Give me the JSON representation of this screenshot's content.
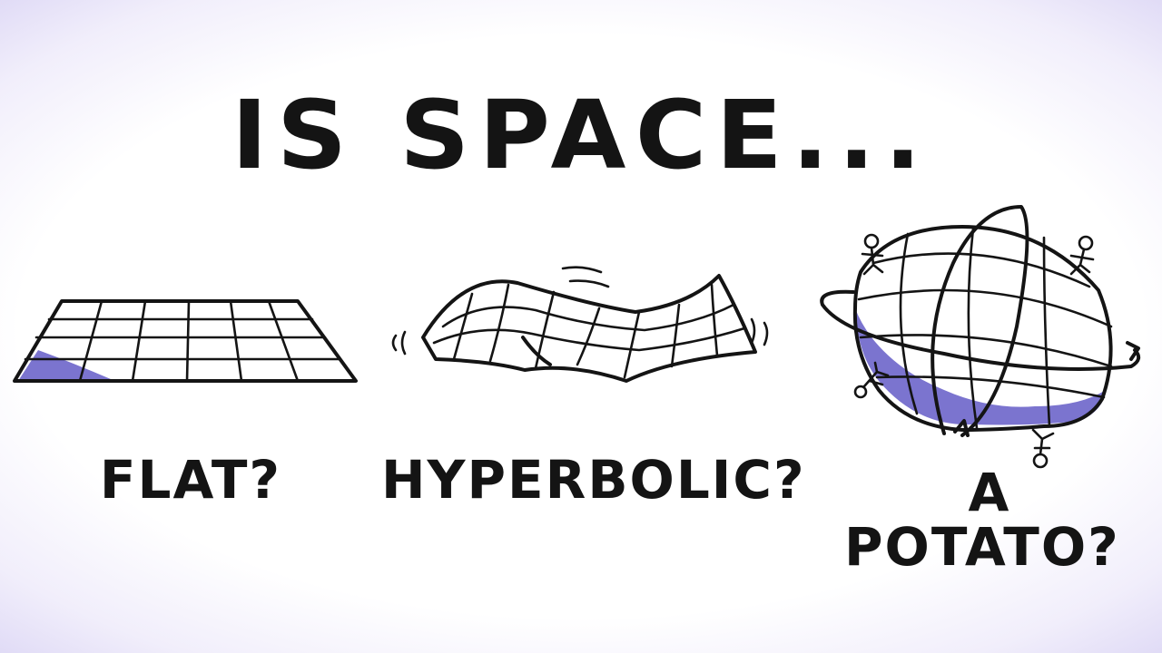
{
  "title": "IS SPACE...",
  "options": {
    "flat": "FLAT?",
    "hyperbolic": "HYPERBOLIC?",
    "potato_line1": "A",
    "potato_line2": "POTATO?"
  },
  "colors": {
    "ink": "#141414",
    "shade": "#7b74cf",
    "vignette": "#d9d3f4"
  },
  "icons": [
    "flat-grid-icon",
    "saddle-surface-icon",
    "potato-surface-icon",
    "stick-figure-icon"
  ]
}
